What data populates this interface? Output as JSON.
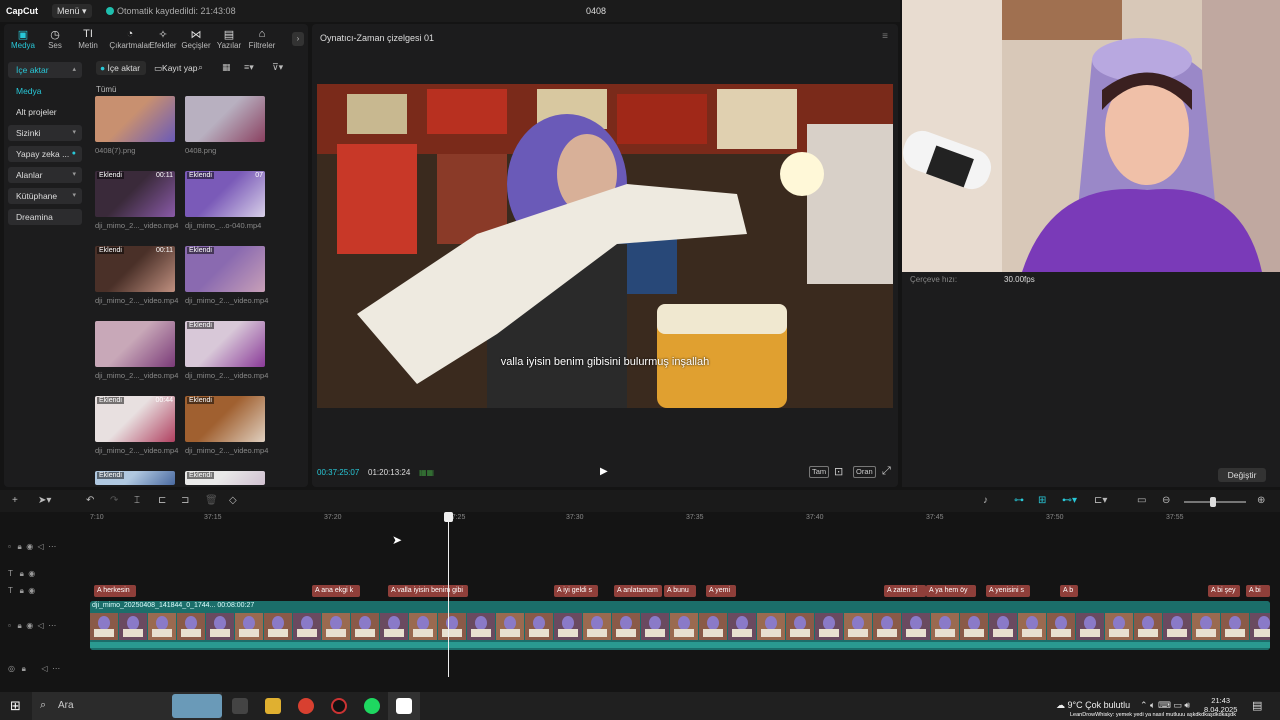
{
  "app": {
    "logo": "CapCut",
    "menu_label": "Menü",
    "autosave": "Otomatik kaydedildi: 21:43:08",
    "project_title": "0408"
  },
  "categories": [
    "Medya",
    "Ses",
    "Metin",
    "Çıkartmalar",
    "Efektler",
    "Geçişler",
    "Yazılar",
    "Filtreler"
  ],
  "nav": [
    {
      "label": "İçe aktar",
      "selected": true,
      "chevron": true
    },
    {
      "label": "Medya",
      "plain": true,
      "accent": true
    },
    {
      "label": "Alt projeler",
      "plain": true
    },
    {
      "label": "Sizinki",
      "chevron": true
    },
    {
      "label": "Yapay zeka ...",
      "chevron": false
    },
    {
      "label": "Alanlar",
      "chevron": true
    },
    {
      "label": "Kütüphane",
      "chevron": true
    },
    {
      "label": "Dreamina"
    }
  ],
  "media": {
    "import_label": "İçe aktar",
    "record_label": "Kayıt yap",
    "all_label": "Tümü",
    "items": [
      {
        "name": "0408(7).png",
        "badge": "",
        "dur": ""
      },
      {
        "name": "0408.png",
        "badge": "",
        "dur": ""
      },
      {
        "name": "dji_mimo_2..._video.mp4",
        "badge": "Eklendi",
        "dur": "00:11"
      },
      {
        "name": "dji_mimo_...o-040.mp4",
        "badge": "Eklendi",
        "dur": "07"
      },
      {
        "name": "dji_mimo_2..._video.mp4",
        "badge": "Eklendi",
        "dur": "00:11"
      },
      {
        "name": "dji_mimo_2..._video.mp4",
        "badge": "Eklendi",
        "dur": ""
      },
      {
        "name": "dji_mimo_2..._video.mp4",
        "badge": "",
        "dur": ""
      },
      {
        "name": "dji_mimo_2..._video.mp4",
        "badge": "Eklendi",
        "dur": ""
      },
      {
        "name": "dji_mimo_2..._video.mp4",
        "badge": "Eklendi",
        "dur": "00:44"
      },
      {
        "name": "dji_mimo_2..._video.mp4",
        "badge": "Eklendi",
        "dur": ""
      },
      {
        "name": "",
        "badge": "Eklendi",
        "dur": ""
      },
      {
        "name": "",
        "badge": "Eklendi",
        "dur": ""
      }
    ]
  },
  "player": {
    "title": "Oynatıcı-Zaman çizelgesi 01",
    "subtitle": "valla iyisin benim gibisini bulurmuş inşallah",
    "current_time": "00:37:25:07",
    "total_time": "01:20:13:24",
    "btn_full": "Tam",
    "btn_ratio": "Oran"
  },
  "properties": {
    "frame_rate_label": "Çerçeve hızı:",
    "frame_rate_value": "30.00fps",
    "change_label": "Değiştir"
  },
  "timeline": {
    "ticks": [
      "7:10",
      "37:15",
      "37:20",
      "|37:25",
      "37:30",
      "37:35",
      "37:40",
      "37:45",
      "37:50",
      "37:55"
    ],
    "text_clips": [
      "herkesin",
      "ana ekgi k",
      "valla iyisin benim gibi",
      "iyi geldi s",
      "anlatamam",
      "bunu",
      "yemi",
      "zaten si",
      "ya hem öy",
      "yenisini s",
      "b",
      "bi şey",
      "bi"
    ],
    "main_clip_label": "dji_mimo_20250408_141844_0_1744... 00:08:00:27"
  },
  "taskbar": {
    "search": "Ara",
    "weather": "9°C  Çok bulutlu",
    "time": "21:43",
    "date": "8.04.2025",
    "ticker": "LeanDrowWhisky: yemek yedi ya nasıl mutluuu aşkdkdkaşdkdkaşdk"
  },
  "colors": {
    "accent": "#28c8d8",
    "text_clip": "#8f3f3a",
    "video_clip": "#1b6e6a"
  }
}
